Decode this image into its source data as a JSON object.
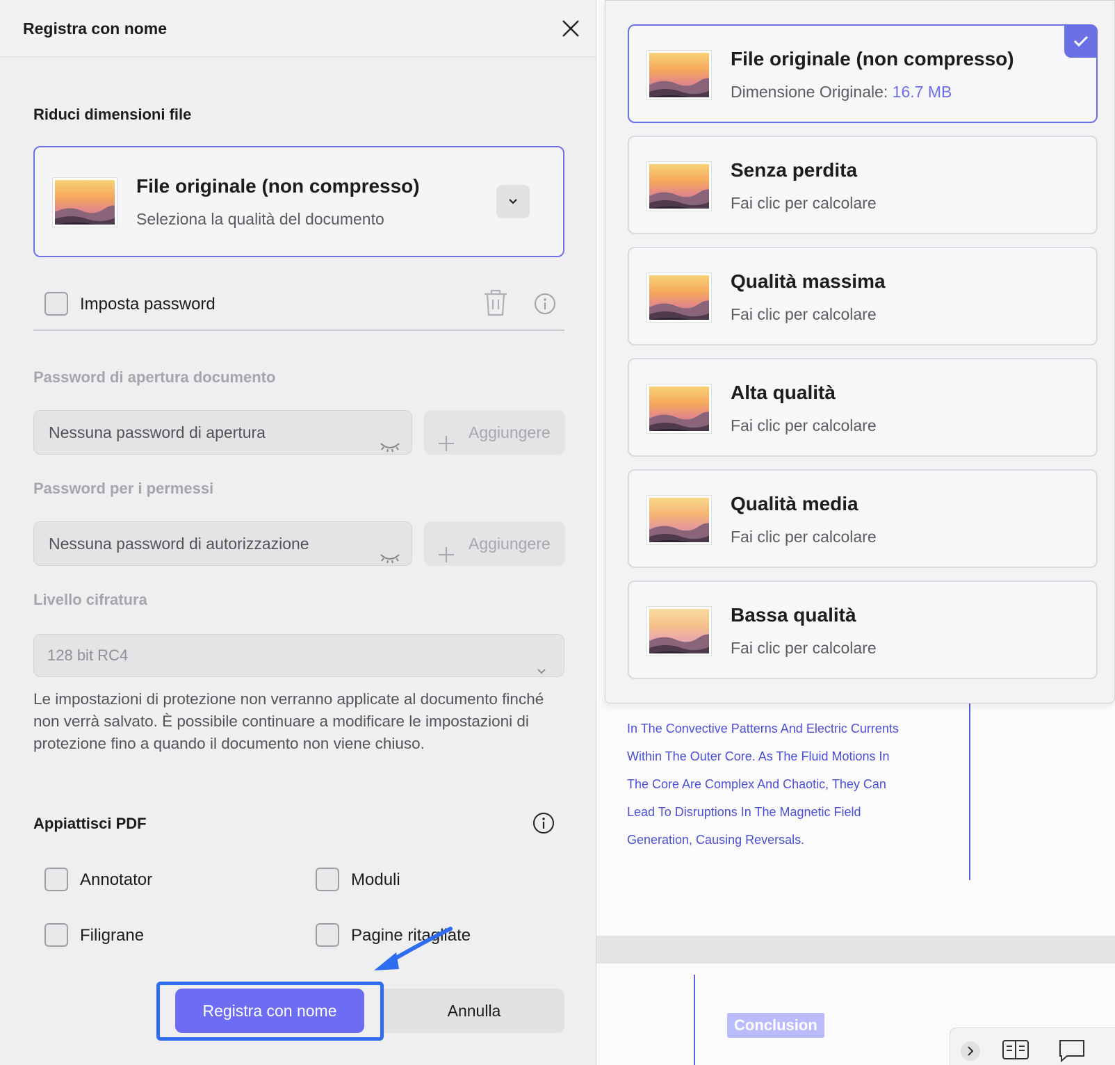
{
  "dialog": {
    "title": "Registra con nome",
    "reduce_section": "Riduci dimensioni file",
    "quality_select": {
      "title": "File originale (non compresso)",
      "subtitle": "Seleziona la qualità del documento"
    },
    "password_checkbox": {
      "label": "Imposta password",
      "checked": false
    },
    "open_password": {
      "label": "Password di apertura documento",
      "placeholder": "Nessuna password di apertura",
      "add_label": "Aggiungere"
    },
    "permission_password": {
      "label": "Password per i permessi",
      "placeholder": "Nessuna password di autorizzazione",
      "add_label": "Aggiungere"
    },
    "encryption": {
      "label": "Livello cifratura",
      "value": "128 bit RC4"
    },
    "note": "Le impostazioni di protezione non verranno applicate al documento finché non verrà salvato. È possibile continuare a modificare le impostazioni di protezione fino a quando il documento non viene chiuso.",
    "flatten": {
      "title": "Appiattisci PDF",
      "options": [
        {
          "label": "Annotator",
          "checked": false
        },
        {
          "label": "Moduli",
          "checked": false
        },
        {
          "label": "Filigrane",
          "checked": false
        },
        {
          "label": "Pagine ritagliate",
          "checked": false
        }
      ]
    },
    "buttons": {
      "save": "Registra con nome",
      "cancel": "Annulla"
    }
  },
  "quality_dropdown": {
    "options": [
      {
        "title": "File originale (non compresso)",
        "sub_prefix": "Dimensione Originale: ",
        "size": "16.7 MB",
        "selected": true
      },
      {
        "title": "Senza perdita",
        "sub": "Fai clic per calcolare",
        "selected": false
      },
      {
        "title": "Qualità massima",
        "sub": "Fai clic per calcolare",
        "selected": false
      },
      {
        "title": "Alta qualità",
        "sub": "Fai clic per calcolare",
        "selected": false
      },
      {
        "title": "Qualità media",
        "sub": "Fai clic per calcolare",
        "selected": false
      },
      {
        "title": "Bassa qualità",
        "sub": "Fai clic per calcolare",
        "selected": false
      }
    ]
  },
  "document": {
    "lines": [
      "In The Convective Patterns And Electric Currents",
      "Within The Outer Core. As The Fluid Motions In",
      "The Core Are Complex And Chaotic, They Can",
      "Lead To Disruptions In The Magnetic Field",
      "Generation, Causing Reversals."
    ],
    "conclusion_label": "Conclusion"
  },
  "colors": {
    "accent": "#6c6df2",
    "highlight": "#2e6cf0",
    "doc_text": "#4b4fd6"
  },
  "icons": [
    "close-icon",
    "chevron-down-icon",
    "trash-icon",
    "info-icon",
    "eye-closed-icon",
    "plus-icon",
    "check-icon",
    "arrow-icon"
  ]
}
